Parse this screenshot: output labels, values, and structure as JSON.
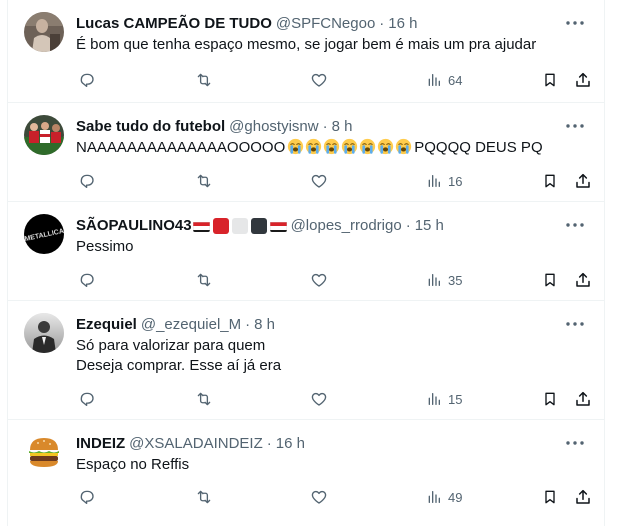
{
  "tweets": [
    {
      "name": "Lucas CAMPEÃO DE TUDO",
      "handle": "@SPFCNegoo",
      "dot": "·",
      "time": "16 h",
      "lines": [
        "É bom que tenha espaço mesmo, se jogar bem é mais um pra ajudar"
      ],
      "views": "64",
      "avatar_icon": "person-sitting-avatar"
    },
    {
      "name": "Sabe tudo do futebol",
      "handle": "@ghostyisnw",
      "dot": "·",
      "time": "8 h",
      "text_before": "NAAAAAAAAAAAAAAOOOOO",
      "emoji_icon": "loudly-crying-face-emoji",
      "emoji_count": 7,
      "text_after": "PQQQQ DEUS PQ",
      "views": "16",
      "avatar_icon": "football-team-avatar"
    },
    {
      "name": "SÃOPAULINO43",
      "handle": "@lopes_rrodrigo",
      "dot": "·",
      "time": "15 h",
      "name_emojis": [
        "spfc-flag-emoji",
        "red-square-emoji",
        "white-square-emoji",
        "black-square-emoji",
        "spfc-flag-emoji"
      ],
      "lines": [
        "Pessimo"
      ],
      "views": "35",
      "avatar_icon": "metallica-logo-avatar",
      "avatar_text": "METALLICA"
    },
    {
      "name": "Ezequiel",
      "handle": "@_ezequiel_M",
      "dot": "·",
      "time": "8 h",
      "lines": [
        "Só para valorizar para quem",
        "Deseja comprar. Esse aí já era"
      ],
      "views": "15",
      "avatar_icon": "person-suit-avatar"
    },
    {
      "name": "INDEIZ",
      "handle": "@XSALADAINDEIZ",
      "dot": "·",
      "time": "16 h",
      "lines": [
        "Espaço no Reffis"
      ],
      "views": "49",
      "avatar_icon": "burger-avatar"
    }
  ],
  "colors": {
    "text": "#0f1419",
    "secondary": "#536471",
    "border": "#eff3f4",
    "flag_red": "#d8232a",
    "flag_black": "#1a1a1a"
  },
  "icons": {
    "reply": "reply-icon",
    "retweet": "retweet-icon",
    "like": "like-icon",
    "views": "views-icon",
    "bookmark": "bookmark-icon",
    "share": "share-icon",
    "more": "more-options-icon"
  }
}
